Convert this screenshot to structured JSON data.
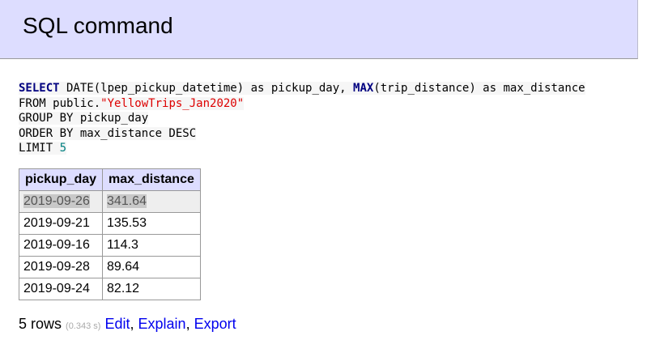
{
  "header": {
    "title": "SQL command"
  },
  "query": {
    "line1": {
      "kw1": "SELECT",
      "text1": " DATE(lpep_pickup_datetime) as pickup_day, ",
      "kw2": "MAX",
      "text2": "(trip_distance) as max_distance"
    },
    "line2": {
      "text": "FROM public.",
      "string": "\"YellowTrips_Jan2020\""
    },
    "line3": "GROUP BY pickup_day",
    "line4": "ORDER BY max_distance DESC",
    "line5": {
      "text": "LIMIT ",
      "number": "5"
    }
  },
  "results": {
    "columns": [
      "pickup_day",
      "max_distance"
    ],
    "rows": [
      [
        "2019-09-26",
        "341.64"
      ],
      [
        "2019-09-21",
        "135.53"
      ],
      [
        "2019-09-16",
        "114.3"
      ],
      [
        "2019-09-28",
        "89.64"
      ],
      [
        "2019-09-24",
        "82.12"
      ]
    ]
  },
  "footer": {
    "row_count": "5 rows",
    "timing": "(0.343 s)",
    "edit_link": "Edit",
    "explain_link": "Explain",
    "export_link": "Export",
    "separator": ","
  },
  "colors": {
    "header_bg": "#ddddff",
    "keyword": "#000080",
    "string": "#dd0000",
    "number": "#008080",
    "link": "#0000ee"
  }
}
